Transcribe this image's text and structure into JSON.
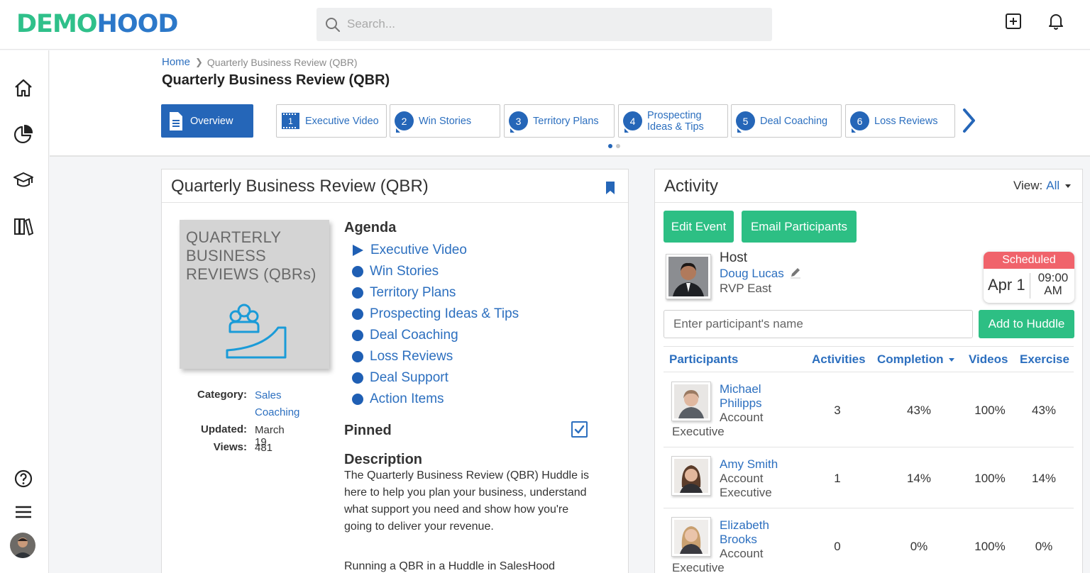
{
  "app": {
    "logo_left": "DEMO",
    "logo_right": "HOOD",
    "search_placeholder": "Search..."
  },
  "breadcrumb": {
    "home": "Home",
    "current": "Quarterly Business Review (QBR)"
  },
  "page_title": "Quarterly Business Review (QBR)",
  "tabs": [
    {
      "num": "",
      "label": "Overview",
      "icon": "document-icon"
    },
    {
      "num": "1",
      "label": "Executive Video",
      "icon": "film-icon"
    },
    {
      "num": "2",
      "label": "Win Stories"
    },
    {
      "num": "3",
      "label": "Territory Plans"
    },
    {
      "num": "4",
      "label_line1": "Prospecting",
      "label_line2": "Ideas & Tips"
    },
    {
      "num": "5",
      "label": "Deal Coaching"
    },
    {
      "num": "6",
      "label": "Loss Reviews"
    }
  ],
  "left_card": {
    "title": "Quarterly Business Review (QBR)",
    "thumbnail_text": [
      "QUARTERLY",
      "BUSINESS",
      "REVIEWS (QBRs)"
    ],
    "meta": {
      "category_label": "Category:",
      "category_line1": "Sales",
      "category_line2": "Coaching",
      "updated_label": "Updated:",
      "updated_value": "March 19",
      "views_label": "Views:",
      "views_value": "481"
    },
    "agenda_title": "Agenda",
    "agenda": [
      "Executive Video",
      "Win Stories",
      "Territory Plans",
      "Prospecting Ideas & Tips",
      "Deal Coaching",
      "Loss Reviews",
      "Deal Support",
      "Action Items"
    ],
    "pinned_label": "Pinned",
    "description_label": "Description",
    "description": "The Quarterly Business Review (QBR) Huddle is here to help you plan your business, understand what support you need and show how you're going to deliver your revenue.",
    "description_2": "Running a QBR in a Huddle in SalesHood"
  },
  "activity": {
    "title": "Activity",
    "view_label": "View:",
    "view_value": "All",
    "edit_event": "Edit Event",
    "email_participants": "Email Participants",
    "host_label": "Host",
    "host_name": "Doug Lucas",
    "host_role": "RVP East",
    "status": "Scheduled",
    "date": "Apr 1",
    "time_line1": "09:00",
    "time_line2": "AM",
    "participant_placeholder": "Enter participant's name",
    "add_button": "Add to Huddle",
    "columns": [
      "Participants",
      "Activities",
      "Completion",
      "Videos",
      "Exercise"
    ],
    "participants": [
      {
        "name_line1": "Michael",
        "name_line2": "Philipps",
        "role_line1": "Account",
        "role_line2": "Executive",
        "activities": "3",
        "completion": "43%",
        "videos": "100%",
        "exercise": "43%"
      },
      {
        "name_line1": "Amy Smith",
        "name_line2": "",
        "role_line1": "Account",
        "role_line2": "Executive",
        "activities": "1",
        "completion": "14%",
        "videos": "100%",
        "exercise": "14%"
      },
      {
        "name_line1": "Elizabeth",
        "name_line2": "Brooks",
        "role_line1": "Account",
        "role_line2": "Executive",
        "activities": "0",
        "completion": "0%",
        "videos": "100%",
        "exercise": "0%"
      }
    ]
  },
  "colors": {
    "green": "#2dbf84",
    "blue": "#2566b8",
    "link": "#2c6fbf",
    "scheduled": "#f0636b"
  }
}
